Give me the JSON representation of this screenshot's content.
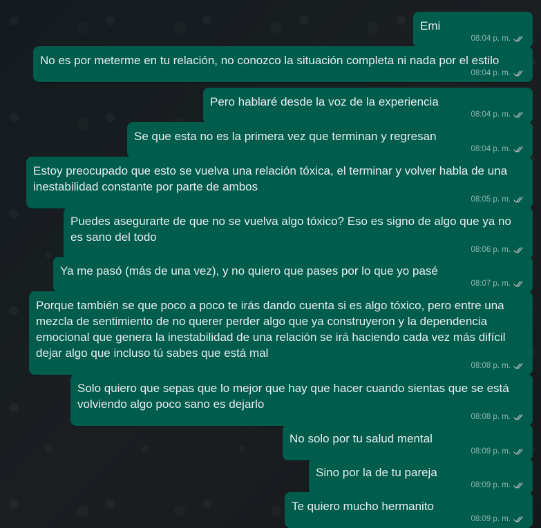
{
  "chat": {
    "messages": [
      {
        "text": "Emi",
        "time": "08:04 p. m."
      },
      {
        "text": "No es por meterme en tu relación, no conozco la situación completa ni nada por el estilo",
        "time": "08:04 p. m."
      },
      {
        "text": "Pero hablaré desde la voz de la experiencia",
        "time": "08:04 p. m."
      },
      {
        "text": "Se que esta no es la primera vez que terminan y regresan",
        "time": "08:04 p. m."
      },
      {
        "text": "Estoy preocupado que esto se vuelva una relación tóxica, el terminar y volver habla de una inestabilidad constante por parte de ambos",
        "time": "08:05 p. m."
      },
      {
        "text": "Puedes asegurarte de que no se vuelva algo tóxico? Eso es signo de algo que ya no es sano del todo",
        "time": "08:06 p. m."
      },
      {
        "text": "Ya me pasó (más de una vez), y no quiero que pases por lo que yo pasé",
        "time": "08:07 p. m."
      },
      {
        "text": "Porque también se que poco a poco te irás dando cuenta si es algo tóxico, pero entre una mezcla de sentimiento de no querer perder algo que ya construyeron y la dependencia emocional que genera la inestabilidad de una relación se irá haciendo cada vez más difícil dejar algo que incluso tú sabes que está mal",
        "time": "08:08 p. m."
      },
      {
        "text": "Solo quiero que sepas que lo mejor que hay que hacer cuando sientas que se está volviendo algo poco sano es dejarlo",
        "time": "08:08 p. m."
      },
      {
        "text": "No solo por tu salud mental",
        "time": "08:09 p. m."
      },
      {
        "text": "Sino por la de tu pareja",
        "time": "08:09 p. m."
      },
      {
        "text": "Te quiero mucho hermanito",
        "time": "08:09 p. m."
      }
    ]
  },
  "colors": {
    "outgoing_bubble": "#005c4b",
    "text": "#e9edef",
    "meta": "#a6b1b4",
    "background": "#1b1f22"
  },
  "icons": {
    "status": "double-check-icon"
  }
}
